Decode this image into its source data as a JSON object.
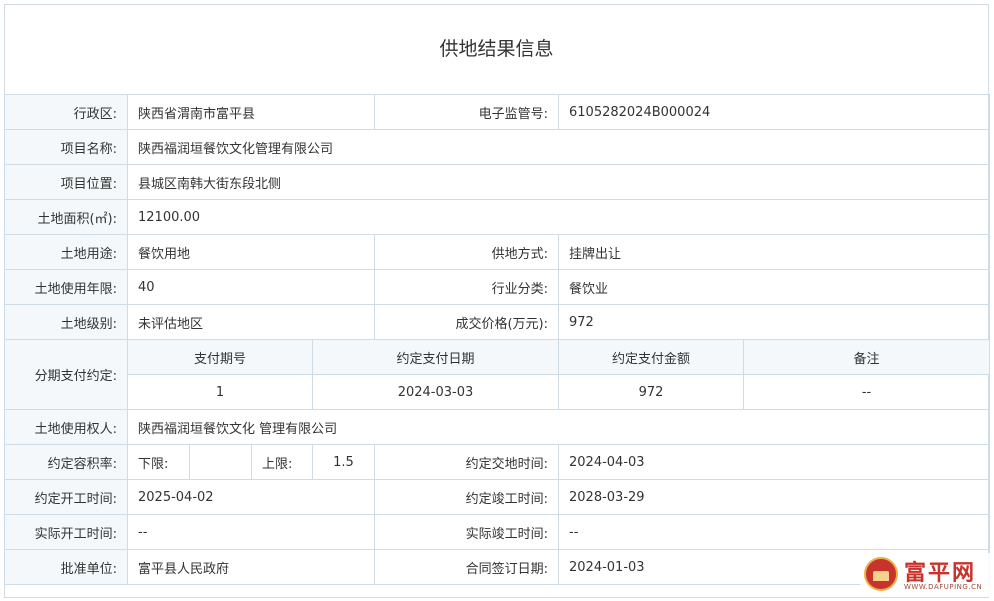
{
  "title": "供地结果信息",
  "rows": {
    "district": {
      "label": "行政区:",
      "value": "陕西省渭南市富平县"
    },
    "supervision_no": {
      "label": "电子监管号:",
      "value": "6105282024B000024"
    },
    "project_name": {
      "label": "项目名称:",
      "value": "陕西福润垣餐饮文化管理有限公司"
    },
    "project_location": {
      "label": "项目位置:",
      "value": "县城区南韩大街东段北侧"
    },
    "land_area": {
      "label": "土地面积(㎡):",
      "value": "12100.00"
    },
    "land_use": {
      "label": "土地用途:",
      "value": "餐饮用地"
    },
    "supply_method": {
      "label": "供地方式:",
      "value": "挂牌出让"
    },
    "use_years": {
      "label": "土地使用年限:",
      "value": "40"
    },
    "industry": {
      "label": "行业分类:",
      "value": "餐饮业"
    },
    "land_grade": {
      "label": "土地级别:",
      "value": "未评估地区"
    },
    "price": {
      "label": "成交价格(万元):",
      "value": "972"
    },
    "installment": {
      "label": "分期支付约定:",
      "headers": [
        "支付期号",
        "约定支付日期",
        "约定支付金额",
        "备注"
      ],
      "rows": [
        {
          "period": "1",
          "date": "2024-03-03",
          "amount": "972",
          "note": "--"
        }
      ]
    },
    "land_user": {
      "label": "土地使用权人:",
      "value": "陕西福润垣餐饮文化 管理有限公司"
    },
    "plot_ratio": {
      "label": "约定容积率:",
      "lower_label": "下限:",
      "lower_value": "",
      "upper_label": "上限:",
      "upper_value": "1.5"
    },
    "delivery_time": {
      "label": "约定交地时间:",
      "value": "2024-04-03"
    },
    "start_time": {
      "label": "约定开工时间:",
      "value": "2025-04-02"
    },
    "completion_time": {
      "label": "约定竣工时间:",
      "value": "2028-03-29"
    },
    "actual_start": {
      "label": "实际开工时间:",
      "value": "--"
    },
    "actual_completion": {
      "label": "实际竣工时间:",
      "value": "--"
    },
    "approval_unit": {
      "label": "批准单位:",
      "value": "富平县人民政府"
    },
    "contract_date": {
      "label": "合同签订日期:",
      "value": "2024-01-03"
    }
  },
  "watermark": {
    "name": "富平网",
    "url": "WWW.DAFUPING.CN",
    "icon": "city-gate-logo-icon"
  },
  "colors": {
    "border": "#cfdce6",
    "label_bg": "#f4f8fb",
    "text": "#333333",
    "brand": "#c8332b"
  }
}
